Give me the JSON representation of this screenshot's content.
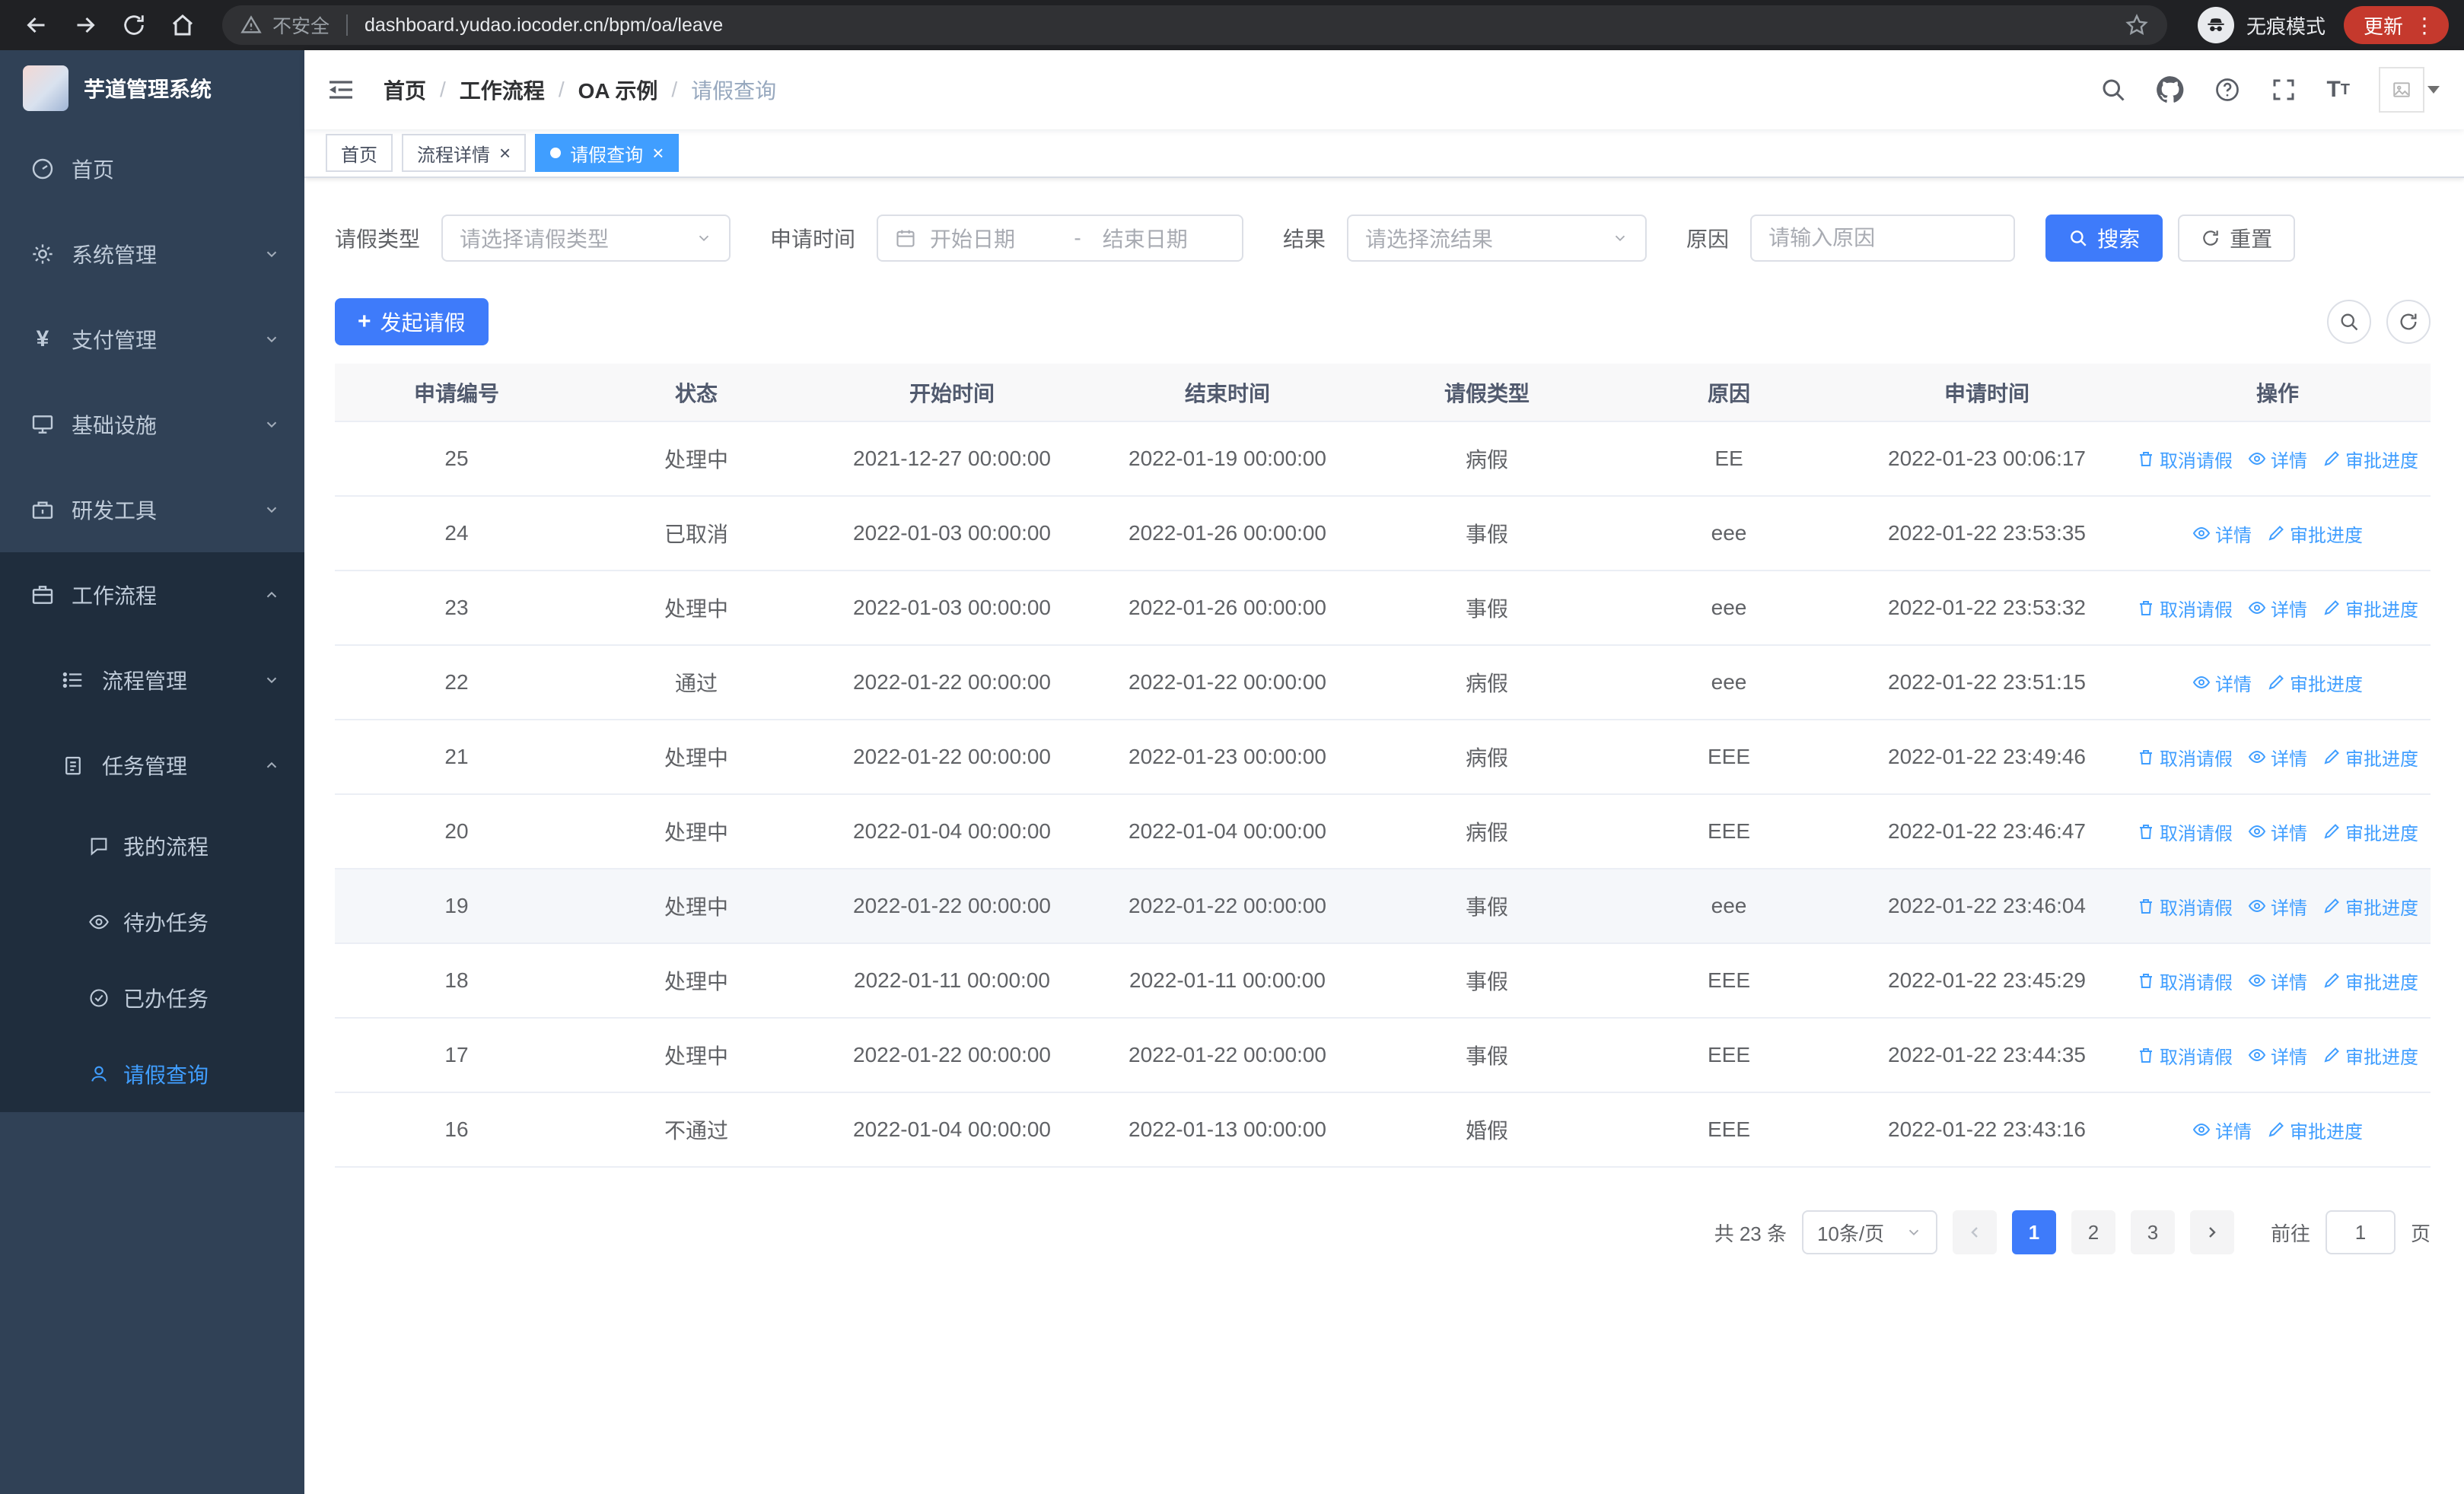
{
  "colors": {
    "primary": "#3e7bfa",
    "link": "#409eff"
  },
  "browser": {
    "security_label": "不安全",
    "url": "dashboard.yudao.iocoder.cn/bpm/oa/leave",
    "incognito_label": "无痕模式",
    "update_label": "更新"
  },
  "sidebar": {
    "title": "芋道管理系统",
    "items": [
      {
        "label": "首页"
      },
      {
        "label": "系统管理"
      },
      {
        "label": "支付管理"
      },
      {
        "label": "基础设施"
      },
      {
        "label": "研发工具"
      },
      {
        "label": "工作流程"
      },
      {
        "label": "流程管理"
      },
      {
        "label": "任务管理"
      },
      {
        "label": "我的流程"
      },
      {
        "label": "待办任务"
      },
      {
        "label": "已办任务"
      },
      {
        "label": "请假查询"
      }
    ]
  },
  "breadcrumb": [
    "首页",
    "工作流程",
    "OA 示例",
    "请假查询"
  ],
  "tabs": [
    {
      "label": "首页"
    },
    {
      "label": "流程详情"
    },
    {
      "label": "请假查询"
    }
  ],
  "filters": {
    "leave_type_label": "请假类型",
    "leave_type_placeholder": "请选择请假类型",
    "apply_time_label": "申请时间",
    "start_date_placeholder": "开始日期",
    "range_separator": "-",
    "end_date_placeholder": "结束日期",
    "result_label": "结果",
    "result_placeholder": "请选择流结果",
    "reason_label": "原因",
    "reason_placeholder": "请输入原因",
    "search_label": "搜索",
    "reset_label": "重置"
  },
  "toolbar": {
    "create_label": "发起请假"
  },
  "table": {
    "columns": [
      "申请编号",
      "状态",
      "开始时间",
      "结束时间",
      "请假类型",
      "原因",
      "申请时间",
      "操作"
    ],
    "actions": {
      "cancel": "取消请假",
      "detail": "详情",
      "progress": "审批进度"
    },
    "rows": [
      {
        "id": "25",
        "status": "处理中",
        "start": "2021-12-27 00:00:00",
        "end": "2022-01-19 00:00:00",
        "type": "病假",
        "reason": "EE",
        "applied": "2022-01-23 00:06:17",
        "cancellable": true,
        "highlighted": false
      },
      {
        "id": "24",
        "status": "已取消",
        "start": "2022-01-03 00:00:00",
        "end": "2022-01-26 00:00:00",
        "type": "事假",
        "reason": "eee",
        "applied": "2022-01-22 23:53:35",
        "cancellable": false,
        "highlighted": false
      },
      {
        "id": "23",
        "status": "处理中",
        "start": "2022-01-03 00:00:00",
        "end": "2022-01-26 00:00:00",
        "type": "事假",
        "reason": "eee",
        "applied": "2022-01-22 23:53:32",
        "cancellable": true,
        "highlighted": false
      },
      {
        "id": "22",
        "status": "通过",
        "start": "2022-01-22 00:00:00",
        "end": "2022-01-22 00:00:00",
        "type": "病假",
        "reason": "eee",
        "applied": "2022-01-22 23:51:15",
        "cancellable": false,
        "highlighted": false
      },
      {
        "id": "21",
        "status": "处理中",
        "start": "2022-01-22 00:00:00",
        "end": "2022-01-23 00:00:00",
        "type": "病假",
        "reason": "EEE",
        "applied": "2022-01-22 23:49:46",
        "cancellable": true,
        "highlighted": false
      },
      {
        "id": "20",
        "status": "处理中",
        "start": "2022-01-04 00:00:00",
        "end": "2022-01-04 00:00:00",
        "type": "病假",
        "reason": "EEE",
        "applied": "2022-01-22 23:46:47",
        "cancellable": true,
        "highlighted": false
      },
      {
        "id": "19",
        "status": "处理中",
        "start": "2022-01-22 00:00:00",
        "end": "2022-01-22 00:00:00",
        "type": "事假",
        "reason": "eee",
        "applied": "2022-01-22 23:46:04",
        "cancellable": true,
        "highlighted": true
      },
      {
        "id": "18",
        "status": "处理中",
        "start": "2022-01-11 00:00:00",
        "end": "2022-01-11 00:00:00",
        "type": "事假",
        "reason": "EEE",
        "applied": "2022-01-22 23:45:29",
        "cancellable": true,
        "highlighted": false
      },
      {
        "id": "17",
        "status": "处理中",
        "start": "2022-01-22 00:00:00",
        "end": "2022-01-22 00:00:00",
        "type": "事假",
        "reason": "EEE",
        "applied": "2022-01-22 23:44:35",
        "cancellable": true,
        "highlighted": false
      },
      {
        "id": "16",
        "status": "不通过",
        "start": "2022-01-04 00:00:00",
        "end": "2022-01-13 00:00:00",
        "type": "婚假",
        "reason": "EEE",
        "applied": "2022-01-22 23:43:16",
        "cancellable": false,
        "highlighted": false
      }
    ]
  },
  "pagination": {
    "total_label": "共 23 条",
    "page_size_label": "10条/页",
    "pages": [
      "1",
      "2",
      "3"
    ],
    "goto_label": "前往",
    "goto_value": "1",
    "page_unit": "页"
  }
}
